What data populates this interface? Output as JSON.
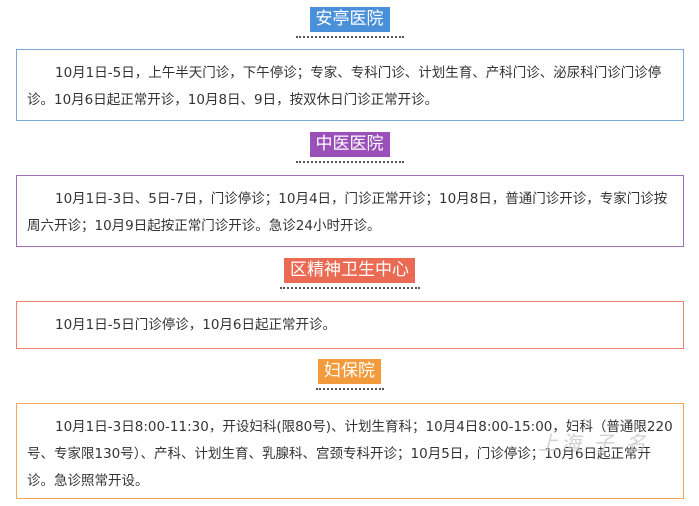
{
  "colors": {
    "anting": "#4a90d9",
    "tcm": "#9b4fb8",
    "mental": "#ea6a53",
    "maternal": "#f39a3d"
  },
  "sections": [
    {
      "title": "安亭医院",
      "text": "10月1日-5日，上午半天门诊，下午停诊；专家、专科门诊、计划生育、产科门诊、泌尿科门诊门诊停诊。10月6日起正常开诊，10月8日、9日，按双休日门诊正常开诊。"
    },
    {
      "title": "中医医院",
      "text": "10月1日-3日、5日-7日，门诊停诊；10月4日，门诊正常开诊；10月8日，普通门诊开诊，专家门诊按周六开诊；10月9日起按正常门诊开诊。急诊24小时开诊。"
    },
    {
      "title": "区精神卫生中心",
      "text": "10月1日-5日门诊停诊，10月6日起正常开诊。"
    },
    {
      "title": "妇保院",
      "text": "10月1日-3日8:00-11:30，开设妇科(限80号)、计划生育科；10月4日8:00-15:00，妇科（普通限220号、专家限130号）、产科、计划生育、乳腺科、宫颈专科开诊；10月5日，门诊停诊；10月6日起正常开诊。急诊照常开设。"
    }
  ]
}
